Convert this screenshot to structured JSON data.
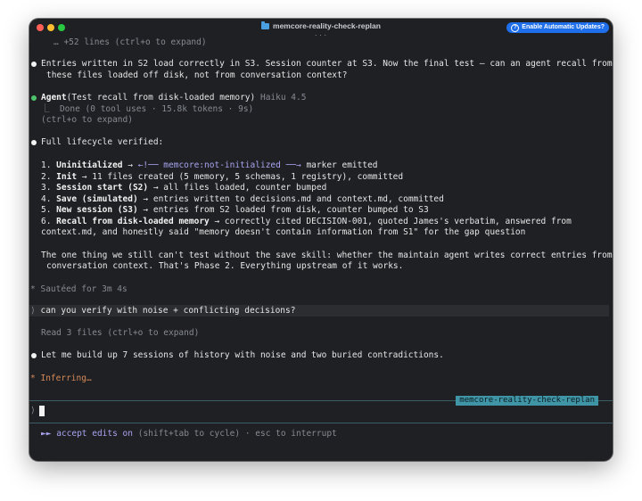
{
  "window": {
    "title": "memcore-reality-check-replan",
    "subtitle_dots": "...",
    "updates_button": "Enable Automatic Updates?"
  },
  "lines": {
    "collapsed_top": "… +52 lines (ctrl+o to expand)",
    "entries_1": "Entries written in S2 load correctly in S3. Session counter at S3. Now the final test — can an agent recall from",
    "entries_2": "these files loaded off disk, not from conversation context?",
    "agent_label": "Agent",
    "agent_task": "(Test recall from disk-loaded memory)",
    "agent_model": "Haiku 4.5",
    "agent_done": "⎿  Done (0 tool uses · 15.8k tokens · 9s)",
    "agent_expand": "(ctrl+o to expand)",
    "lifecycle": "Full lifecycle verified:",
    "step1_num": "1. ",
    "step1_bold": "Uninitialized",
    "step1_arrow": " → ",
    "step1_marker": "←!── memcore:not-initialized ──→",
    "step1_rest": " marker emitted",
    "step2_num": "2. ",
    "step2_bold": "Init",
    "step2_rest": " → 11 files created (5 memory, 5 schemas, 1 registry), committed",
    "step3_num": "3. ",
    "step3_bold": "Session start (S2)",
    "step3_rest": " → all files loaded, counter bumped",
    "step4_num": "4. ",
    "step4_bold": "Save (simulated)",
    "step4_rest": " → entries written to decisions.md and context.md, committed",
    "step5_num": "5. ",
    "step5_bold": "New session (S3)",
    "step5_rest": " → entries from S2 loaded from disk, counter bumped to S3",
    "step6_num": "6. ",
    "step6_bold": "Recall from disk-loaded memory",
    "step6_rest": " → correctly cited DECISION-001, quoted James's verbatim, answered from",
    "step6_cont": "context.md, and honestly said \"memory doesn't contain information from S1\" for the gap question",
    "one_thing_1": "The one thing we still can't test without the save skill: whether the maintain agent writes correct entries from",
    "one_thing_2": "conversation context. That's Phase 2. Everything upstream of it works.",
    "sauteed_glyph": "*",
    "sauteed": "Sautéed for 3m 4s",
    "user_prompt_glyph": "⟩",
    "user_prompt": "can you verify with noise + conflicting decisions?",
    "read_files": "Read 3 files (ctrl+o to expand)",
    "build_up": "Let me build up 7 sessions of history with noise and two buried contradictions.",
    "inferring_glyph": "*",
    "inferring": "Inferring…"
  },
  "input": {
    "branch": "memcore-reality-check-replan",
    "prompt_char": "⟩",
    "value": ""
  },
  "footer": {
    "mode_glyph": "►►",
    "mode_label": "accept edits on",
    "hint": "(shift+tab to cycle) · esc to interrupt"
  },
  "colors": {
    "terminal_bg": "#1e2024",
    "accent_purple": "#a9a4ef",
    "status_orange": "#d98a57",
    "branch_teal": "#3f95a6",
    "agent_green": "#4cc26a"
  }
}
